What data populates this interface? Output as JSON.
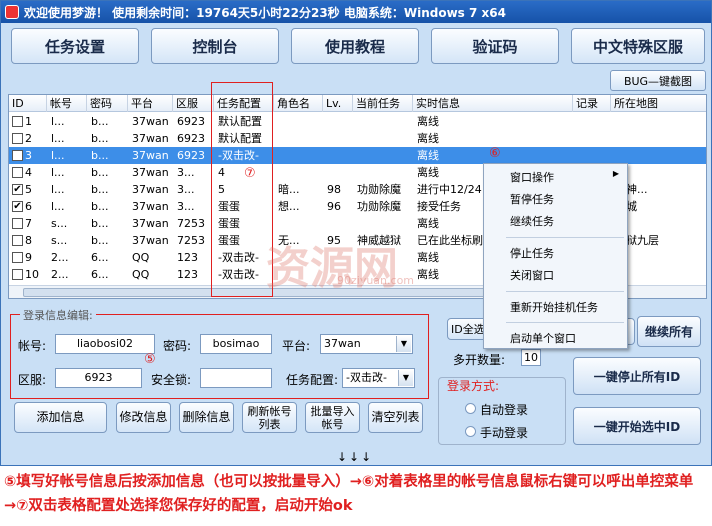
{
  "titlebar": {
    "text": "欢迎使用梦游！ 使用剩余时间：19764天5小时22分23秒   电脑系统：Windows 7 x64"
  },
  "nav": [
    "任务设置",
    "控制台",
    "使用教程",
    "验证码",
    "中文特殊区服"
  ],
  "bug_button": "BUG—键截图",
  "table": {
    "columns": [
      "ID",
      "帐号",
      "密码",
      "平台",
      "区服",
      "任务配置",
      "角色名",
      "Lv.",
      "当前任务",
      "实时信息",
      "记录",
      "所在地图"
    ],
    "rows": [
      {
        "checked": false,
        "id": "1",
        "acct": "l...",
        "pwd": "b...",
        "plat": "37wan",
        "srv": "6923",
        "cfg": "默认配置",
        "role": "",
        "lv": "",
        "task": "",
        "info": "离线",
        "log": "",
        "map": ""
      },
      {
        "checked": false,
        "id": "2",
        "acct": "l...",
        "pwd": "b...",
        "plat": "37wan",
        "srv": "6923",
        "cfg": "默认配置",
        "role": "",
        "lv": "",
        "task": "",
        "info": "离线",
        "log": "",
        "map": ""
      },
      {
        "checked": false,
        "id": "3",
        "acct": "l...",
        "pwd": "b...",
        "plat": "37wan",
        "srv": "6923",
        "cfg": "-双击改-",
        "role": "",
        "lv": "",
        "task": "",
        "info": "离线",
        "log": "",
        "map": ""
      },
      {
        "checked": false,
        "id": "4",
        "acct": "l...",
        "pwd": "b...",
        "plat": "37wan",
        "srv": "3...",
        "cfg": "4",
        "role": "",
        "lv": "",
        "task": "",
        "info": "离线",
        "log": "",
        "map": ""
      },
      {
        "checked": true,
        "id": "5",
        "acct": "l...",
        "pwd": "b...",
        "plat": "37wan",
        "srv": "3...",
        "cfg": "5",
        "role": "暗...",
        "lv": "98",
        "task": "功勋除魔",
        "info": "进行中12/24",
        "log": "",
        "map": "月神..."
      },
      {
        "checked": true,
        "id": "6",
        "acct": "l...",
        "pwd": "b...",
        "plat": "37wan",
        "srv": "3...",
        "cfg": "蛋蛋",
        "role": "想...",
        "lv": "96",
        "task": "功勋除魔",
        "info": "接受任务",
        "log": "",
        "map": "奇城"
      },
      {
        "checked": false,
        "id": "7",
        "acct": "s...",
        "pwd": "b...",
        "plat": "37wan",
        "srv": "7253",
        "cfg": "蛋蛋",
        "role": "",
        "lv": "",
        "task": "",
        "info": "离线",
        "log": "",
        "map": ""
      },
      {
        "checked": false,
        "id": "8",
        "acct": "s...",
        "pwd": "b...",
        "plat": "37wan",
        "srv": "7253",
        "cfg": "蛋蛋",
        "role": "无...",
        "lv": "95",
        "task": "神威越狱",
        "info": "已在此坐标刷",
        "log": "",
        "map": "威狱九层"
      },
      {
        "checked": false,
        "id": "9",
        "acct": "2...",
        "pwd": "6...",
        "plat": "QQ",
        "srv": "123",
        "cfg": "-双击改-",
        "role": "",
        "lv": "",
        "task": "",
        "info": "离线",
        "log": "",
        "map": ""
      },
      {
        "checked": false,
        "id": "10",
        "acct": "2...",
        "pwd": "6...",
        "plat": "QQ",
        "srv": "123",
        "cfg": "-双击改-",
        "role": "",
        "lv": "",
        "task": "",
        "info": "离线",
        "log": "",
        "map": ""
      }
    ]
  },
  "annotations": {
    "c5": "⑤",
    "c6": "⑥",
    "c7": "⑦"
  },
  "context_menu": [
    "窗口操作",
    "暂停任务",
    "继续任务",
    "停止任务",
    "关闭窗口",
    "重新开始挂机任务",
    "启动单个窗口"
  ],
  "edit": {
    "group_title": "登录信息编辑:",
    "account_label": "帐号:",
    "account_value": "liaobosi02",
    "password_label": "密码:",
    "password_value": "bosimao",
    "platform_label": "平台:",
    "platform_value": "37wan",
    "server_label": "区服:",
    "server_value": "6923",
    "lock_label": "安全锁:",
    "lock_value": "",
    "config_label": "任务配置:",
    "config_value": "-双击改-"
  },
  "buttons": {
    "add": "添加信息",
    "modify": "修改信息",
    "delete": "删除信息",
    "refresh": "刷新帐号列表",
    "batch": "批量导入帐号",
    "clear": "清空列表"
  },
  "right": {
    "id_select": "ID全选",
    "continue_all": "继续所有",
    "multi_label": "多开数量:",
    "multi_value": "10",
    "login_title": "登录方式:",
    "auto_login": "自动登录",
    "manual_login": "手动登录",
    "stop_all": "一键停止所有ID",
    "start_selected": "一键开始选中ID"
  },
  "arrows": "↓↓↓",
  "watermark": {
    "main": "资源网",
    "sub": "90ziyuan.com"
  },
  "caption": "⑤填写好帐号信息后按添加信息（也可以按批量导入）→⑥对着表格里的帐号信息鼠标右键可以呼出单控菜单→⑦双击表格配置处选择您保存好的配置，启动开始ok"
}
